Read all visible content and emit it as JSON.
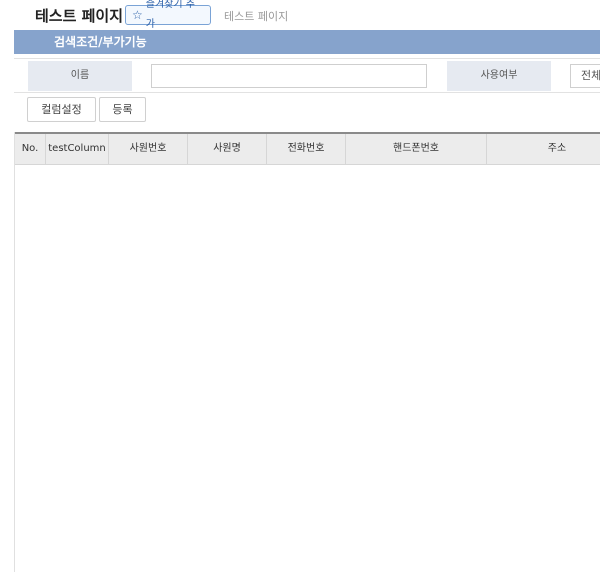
{
  "header": {
    "title": "테스트 페이지",
    "favorite_label": "즐겨찾기 추가",
    "breadcrumb": "테스트 페이지"
  },
  "search": {
    "section_title": "검색조건/부가기능",
    "name_label": "이름",
    "name_value": "",
    "use_label": "사용여부",
    "use_selected": "전체"
  },
  "actions": {
    "column_settings": "컬럼설정",
    "register": "등록"
  },
  "grid": {
    "columns": [
      "No.",
      "testColumn",
      "사원번호",
      "사원명",
      "전화번호",
      "핸드폰번호",
      "주소"
    ],
    "rows": []
  },
  "colors": {
    "section_header": "#86a3cc",
    "label_bg": "#e6eaf1",
    "grid_header_bg": "#ececec",
    "accent": "#2a5fa8"
  }
}
